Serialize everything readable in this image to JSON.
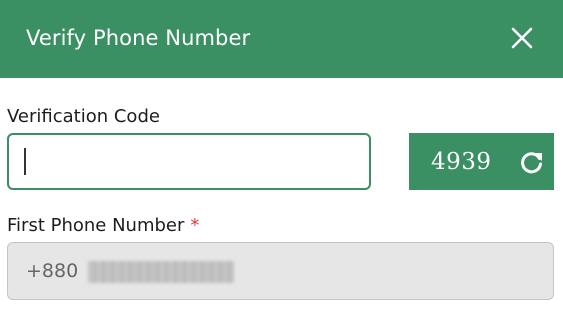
{
  "dialog": {
    "title": "Verify Phone Number",
    "close_icon": "close-icon",
    "header_color": "#3a8f63"
  },
  "verification": {
    "label": "Verification Code",
    "input_value": "",
    "captcha_text": "4939",
    "refresh_icon": "refresh-icon"
  },
  "phone": {
    "label": "First Phone Number",
    "required_mark": "*",
    "prefix": "+880",
    "number_obscured": true
  },
  "colors": {
    "accent": "#3a8f63",
    "required": "#e53935",
    "disabled_bg": "#e6e6e6"
  }
}
